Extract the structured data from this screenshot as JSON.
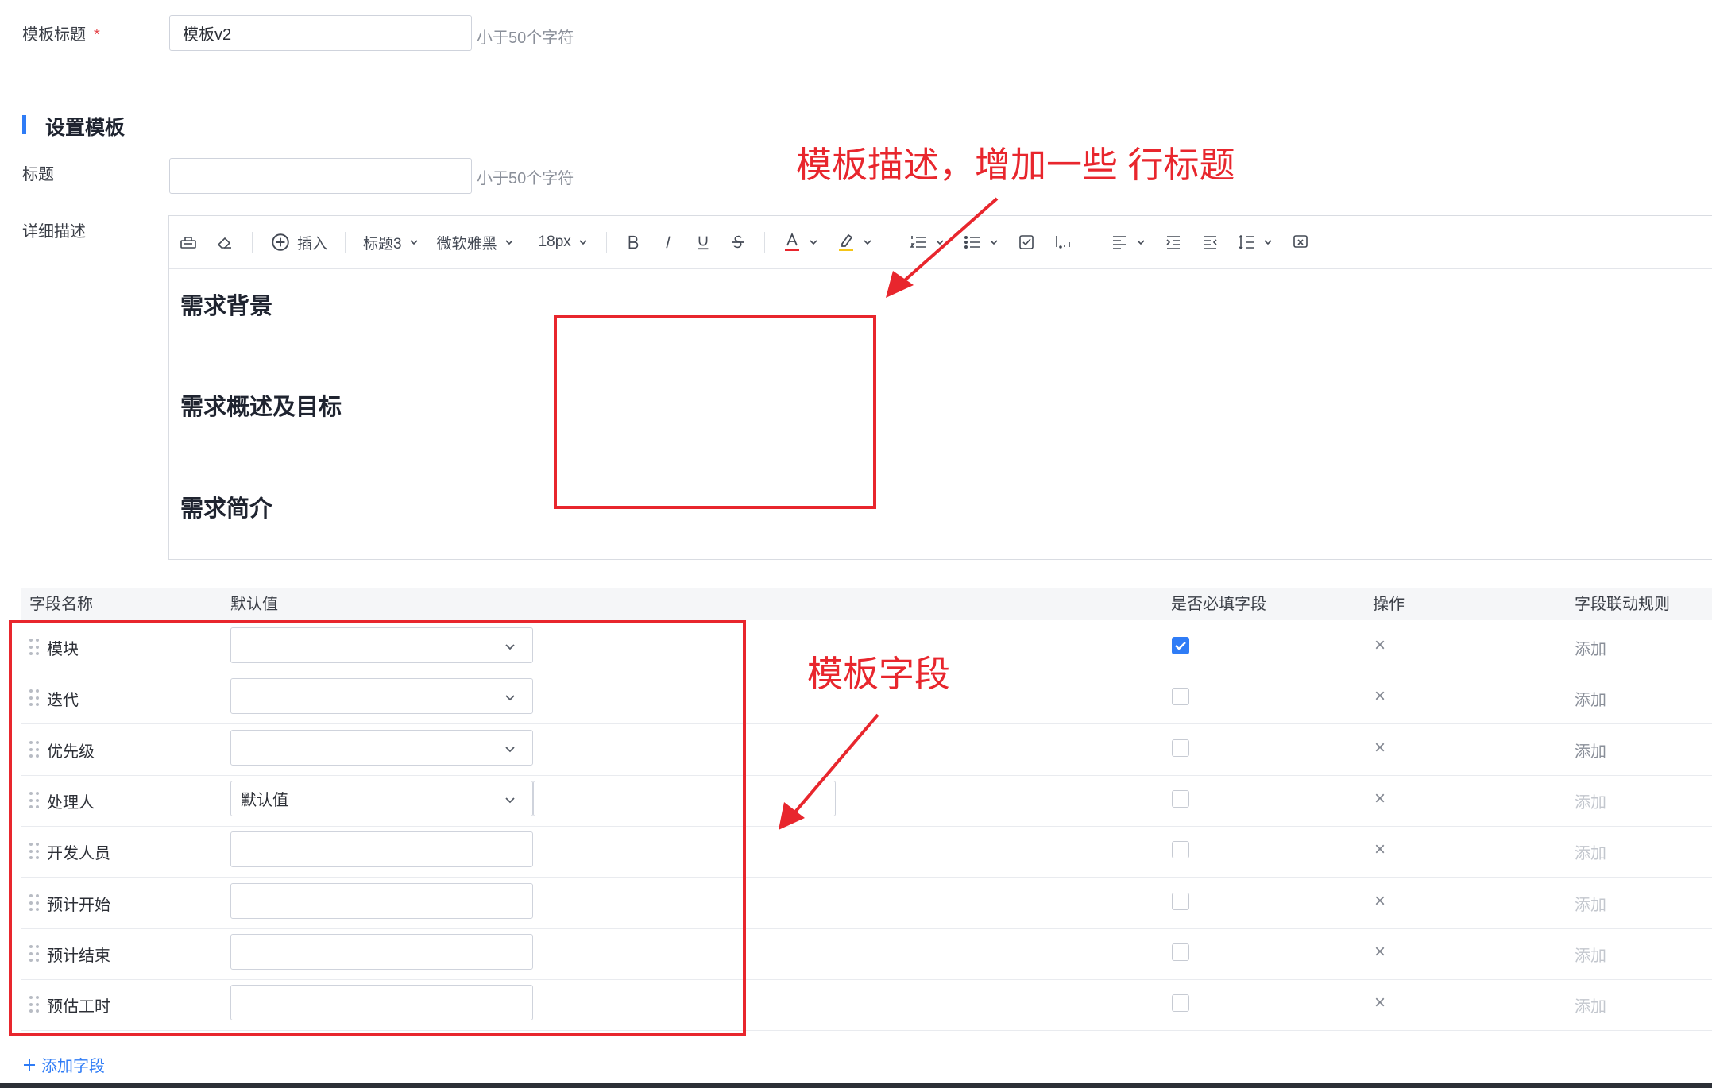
{
  "template_title": {
    "label": "模板标题",
    "required_mark": "*",
    "value": "模板v2",
    "hint": "小于50个字符"
  },
  "section": {
    "title": "设置模板"
  },
  "title_field": {
    "label": "标题",
    "value": "",
    "hint": "小于50个字符"
  },
  "description": {
    "label": "详细描述",
    "toolbar": {
      "insert": "插入",
      "heading": "标题3",
      "font": "微软雅黑",
      "size": "18px"
    },
    "headings": [
      "需求背景",
      "需求概述及目标",
      "需求简介"
    ]
  },
  "table": {
    "headers": {
      "name": "字段名称",
      "default": "默认值",
      "required": "是否必填字段",
      "action": "操作",
      "rule": "字段联动规则"
    },
    "rows": [
      {
        "name": "模块",
        "default": "",
        "type": "select",
        "required": true,
        "add": "添加",
        "add_enabled": true
      },
      {
        "name": "迭代",
        "default": "",
        "type": "select",
        "required": false,
        "add": "添加",
        "add_enabled": true
      },
      {
        "name": "优先级",
        "default": "",
        "type": "select",
        "required": false,
        "add": "添加",
        "add_enabled": true
      },
      {
        "name": "处理人",
        "default": "默认值",
        "type": "select+input",
        "required": false,
        "add": "添加",
        "add_enabled": false
      },
      {
        "name": "开发人员",
        "default": "",
        "type": "input",
        "required": false,
        "add": "添加",
        "add_enabled": false
      },
      {
        "name": "预计开始",
        "default": "",
        "type": "input",
        "required": false,
        "add": "添加",
        "add_enabled": false
      },
      {
        "name": "预计结束",
        "default": "",
        "type": "input",
        "required": false,
        "add": "添加",
        "add_enabled": false
      },
      {
        "name": "预估工时",
        "default": "",
        "type": "input",
        "required": false,
        "add": "添加",
        "add_enabled": false
      }
    ],
    "remove_symbol": "×",
    "add_field": "添加字段"
  },
  "annotations": {
    "editor_note": "模板描述，增加一些 行标题",
    "fields_note": "模板字段"
  },
  "colors": {
    "accent": "#2f7cf6",
    "annotation": "#e8262d",
    "disabled_link": "#c3c7ce",
    "link": "#8a8f99"
  }
}
